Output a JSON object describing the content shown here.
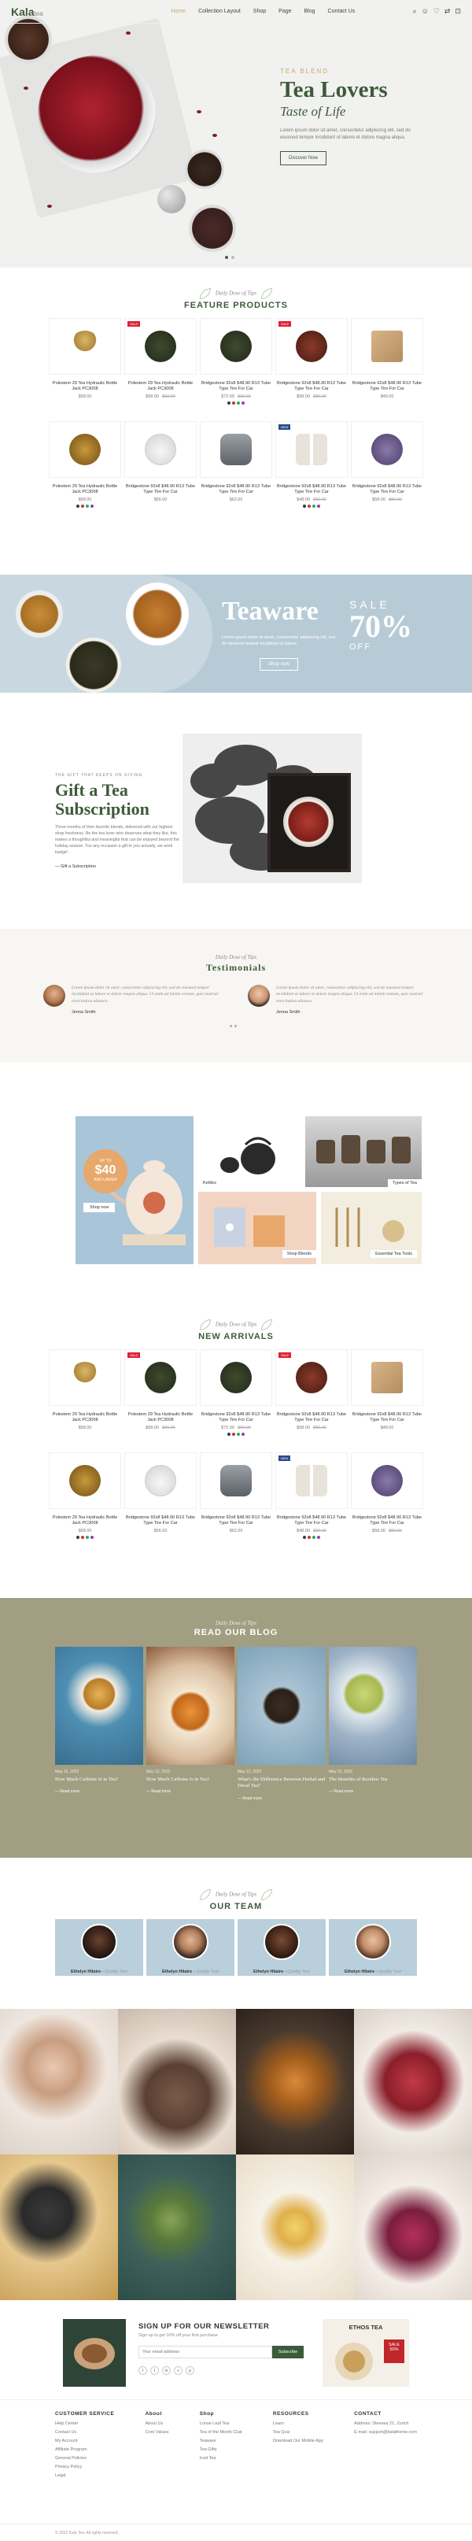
{
  "header": {
    "logo": "Kala",
    "logo_suffix": "tea",
    "nav": [
      "Home",
      "Collection Layout",
      "Shop",
      "Page",
      "Blog",
      "Contact Us"
    ],
    "icons": [
      "search-icon",
      "user-icon",
      "heart-icon",
      "compare-icon",
      "cart-icon"
    ]
  },
  "hero": {
    "pre": "TEA BLEND",
    "title": "Tea Lovers",
    "subtitle": "Taste of Life",
    "text": "Lorem ipsum dolor sit amet, consectetur adipiscing elit, sed do eiusmod tempor incididunt ut labore et dolore magna aliqua.",
    "button": "Discover Now"
  },
  "featured": {
    "tagline": "Daily Dose of Tips",
    "title": "FEATURE PRODUCTS",
    "products": [
      {
        "name": "Polestem 29 Tea Hydraulic Bottle Jack PC3008",
        "price": "$58.00",
        "old": "",
        "badge": "",
        "shape": "whisk"
      },
      {
        "name": "Polestem 29 Tea Hydraulic Bottle Jack PC3008",
        "price": "$68.00",
        "old": "$80.00",
        "badge": "SALE",
        "shape": "leaf-dark"
      },
      {
        "name": "Bridgestone 92x8 $48.90 R13 Tube Type Tire For Car",
        "price": "$72.00",
        "old": "$90.00",
        "badge": "",
        "shape": "leaf-dark"
      },
      {
        "name": "Bridgestone 92x8 $48.90 R13 Tube Type Tire For Car",
        "price": "$58.00",
        "old": "$86.00",
        "badge": "SALE",
        "shape": "leaf-red"
      },
      {
        "name": "Bridgestone 92x8 $48.90 R13 Tube Type Tire For Car",
        "price": "$48.00",
        "old": "",
        "badge": "",
        "shape": "filter"
      },
      {
        "name": "Polestem 29 Tea Hydraulic Bottle Jack PC3008",
        "price": "$58.00",
        "old": "",
        "badge": "",
        "shape": "leaf-gold"
      },
      {
        "name": "Bridgestone 92x8 $48.90 R13 Tube Type Tire For Car",
        "price": "$56.00",
        "old": "",
        "badge": "",
        "shape": "teapot"
      },
      {
        "name": "Bridgestone 92x8 $48.90 R13 Tube Type Tire For Car",
        "price": "$62.00",
        "old": "",
        "badge": "",
        "shape": "kettle"
      },
      {
        "name": "Bridgestone 92x8 $48.90 R13 Tube Type Tire For Car",
        "price": "$48.00",
        "old": "$80.00",
        "badge": "NEW",
        "shape": "cups"
      },
      {
        "name": "Bridgestone 92x8 $48.90 R13 Tube Type Tire For Car",
        "price": "$58.00",
        "old": "$80.00",
        "badge": "",
        "shape": "lavender"
      }
    ]
  },
  "teaware": {
    "title": "Teaware",
    "text": "Lorem ipsum dolor sit amet, consectetur adipiscing elit, sed do eiusmod tempor incididunt ut labore.",
    "button": "Shop now",
    "sale1": "SALE",
    "sale2": "70%",
    "sale3": "OFF"
  },
  "subscription": {
    "pre": "THE GIFT THAT KEEPS ON GIVING",
    "title": "Gift a Tea Subscription",
    "text": "Three months of their favorite blends, delivered with our highest shop freshness. Be the tea lover who deserves what they like, this makes a thoughtful and meaningful that can be enjoyed beyond the holiday season. Too any occasion a gift to you actually, we work badge!",
    "link": "Gift a Subscription"
  },
  "testimonials": {
    "tagline": "Daily Dose of Tips",
    "title": "Testimonials",
    "items": [
      {
        "text": "Lorem ipsum dolor sit amet, consectetur adipiscing elit, sed do eiusmod tempor incididunt ut labore et dolore magna aliqua. Ut enim ad minim veniam, quis nostrud exercitation ullamco.",
        "name": "Jenna Smith"
      },
      {
        "text": "Lorem ipsum dolor sit amet, consectetur adipiscing elit, sed do eiusmod tempor incididunt ut labore et dolore magna aliqua. Ut enim ad minim veniam, quis nostrud exercitation ullamco.",
        "name": "Jenna Smith"
      }
    ]
  },
  "collections": {
    "promo_a": "UP TO",
    "promo_b": "$40",
    "promo_c": "AND UNDER",
    "promo_button": "Shop now",
    "items": [
      "Kettles",
      "Types of Tea",
      "Shop Blends",
      "Essential Tea Tools"
    ]
  },
  "arrivals": {
    "tagline": "Daily Dose of Tips",
    "title": "NEW ARRIVALS"
  },
  "blog": {
    "tagline": "Daily Dose of Tips",
    "title": "READ OUR BLOG",
    "posts": [
      {
        "date": "May 12, 2022",
        "title": "How Much Caffeine Is in Tea?",
        "more": "Read more"
      },
      {
        "date": "May 12, 2022",
        "title": "How Much Caffeine Is in Tea?",
        "more": "Read more"
      },
      {
        "date": "May 12, 2022",
        "title": "What's the Difference Between Herbal and Decaf Tea?",
        "more": "Read more"
      },
      {
        "date": "May 12, 2022",
        "title": "The Benefits of Rooibos Tea",
        "more": "Read more"
      }
    ]
  },
  "team": {
    "tagline": "Daily Dose of Tips",
    "title": "OUR TEAM",
    "members": [
      {
        "name": "Ethelyn Hilaire",
        "role": "Quality Test"
      },
      {
        "name": "Ethelyn Hilaire",
        "role": "Quality Test"
      },
      {
        "name": "Ethelyn Hilaire",
        "role": "Quality Test"
      },
      {
        "name": "Ethelyn Hilaire",
        "role": "Quality Test"
      }
    ]
  },
  "newsletter": {
    "title": "SIGN UP FOR OUR NEWSLETTER",
    "subtitle": "Sign up to get 10% off your first purchase",
    "placeholder": "Your email address",
    "button": "Subscribe",
    "socials": [
      "f",
      "t",
      "in",
      "v",
      "p"
    ],
    "promo_title": "ETHOS TEA",
    "promo_sale": "SALE 50%"
  },
  "footer": {
    "columns": [
      {
        "title": "CUSTOMER SERVICE",
        "items": [
          "Help Center",
          "Contact Us",
          "My Account",
          "Affiliate Program",
          "General Policies",
          "Privacy Policy",
          "Legal"
        ]
      },
      {
        "title": "About",
        "items": [
          "About Us",
          "Core Values"
        ]
      },
      {
        "title": "Shop",
        "items": [
          "Loose Leaf Tea",
          "Tea of the Month Club",
          "Teaware",
          "Tea Gifts",
          "Iced Tea"
        ]
      },
      {
        "title": "RESOURCES",
        "items": [
          "Learn",
          "Tea Quiz",
          "Download Our Mobile App"
        ]
      },
      {
        "title": "CONTACT",
        "items": [
          "Address: Steevea 21, Zurich",
          "E-mail: support@kalatheme.com"
        ]
      }
    ],
    "copyright": "© 2022 Kala Tea. All rights reserved."
  }
}
